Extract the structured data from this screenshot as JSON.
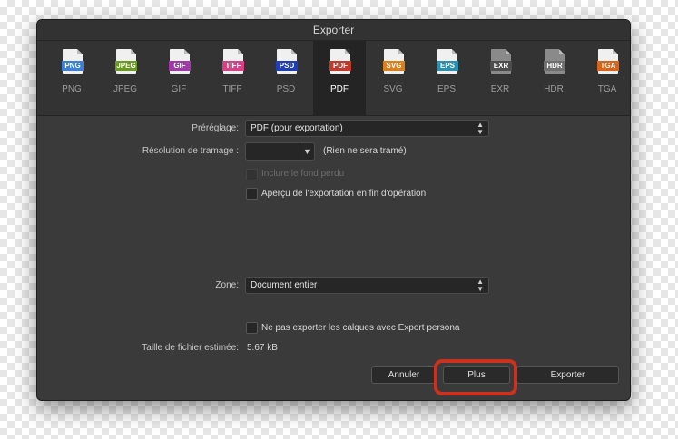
{
  "dialog": {
    "title": "Exporter"
  },
  "formats": [
    {
      "label": "PNG",
      "badge": "PNG",
      "color": "#3b7fd6",
      "dark": false
    },
    {
      "label": "JPEG",
      "badge": "JPEG",
      "color": "#6a9a1f",
      "dark": false
    },
    {
      "label": "GIF",
      "badge": "GIF",
      "color": "#a03aa8",
      "dark": false
    },
    {
      "label": "TIFF",
      "badge": "TIFF",
      "color": "#d83f86",
      "dark": false
    },
    {
      "label": "PSD",
      "badge": "PSD",
      "color": "#1f3fb8",
      "dark": false
    },
    {
      "label": "PDF",
      "badge": "PDF",
      "color": "#c0392b",
      "dark": false,
      "active": true
    },
    {
      "label": "SVG",
      "badge": "SVG",
      "color": "#d9801b",
      "dark": false
    },
    {
      "label": "EPS",
      "badge": "EPS",
      "color": "#2b8fb0",
      "dark": false
    },
    {
      "label": "EXR",
      "badge": "EXR",
      "color": "#4d4d4d",
      "dark": true
    },
    {
      "label": "HDR",
      "badge": "HDR",
      "color": "#6f6f6f",
      "dark": true
    },
    {
      "label": "TGA",
      "badge": "TGA",
      "color": "#d8641a",
      "dark": false
    }
  ],
  "preset": {
    "label": "Préréglage:",
    "value": "PDF (pour exportation)"
  },
  "rasterization": {
    "label": "Résolution de tramage :",
    "value": "",
    "note": "(Rien ne sera tramé)"
  },
  "bleed": {
    "label": "Inclure le fond perdu",
    "checked": false,
    "disabled": true
  },
  "preview": {
    "label": "Aperçu de l'exportation en fin d'opération",
    "checked": false
  },
  "zone": {
    "label": "Zone:",
    "value": "Document entier"
  },
  "layers": {
    "label": "Ne pas exporter les calques avec Export persona",
    "checked": false
  },
  "filesize": {
    "label": "Taille de fichier estimée:",
    "value": "5.67 kB"
  },
  "buttons": {
    "cancel": "Annuler",
    "more": "Plus",
    "export": "Exporter"
  },
  "annotation_color": "#c8321f"
}
